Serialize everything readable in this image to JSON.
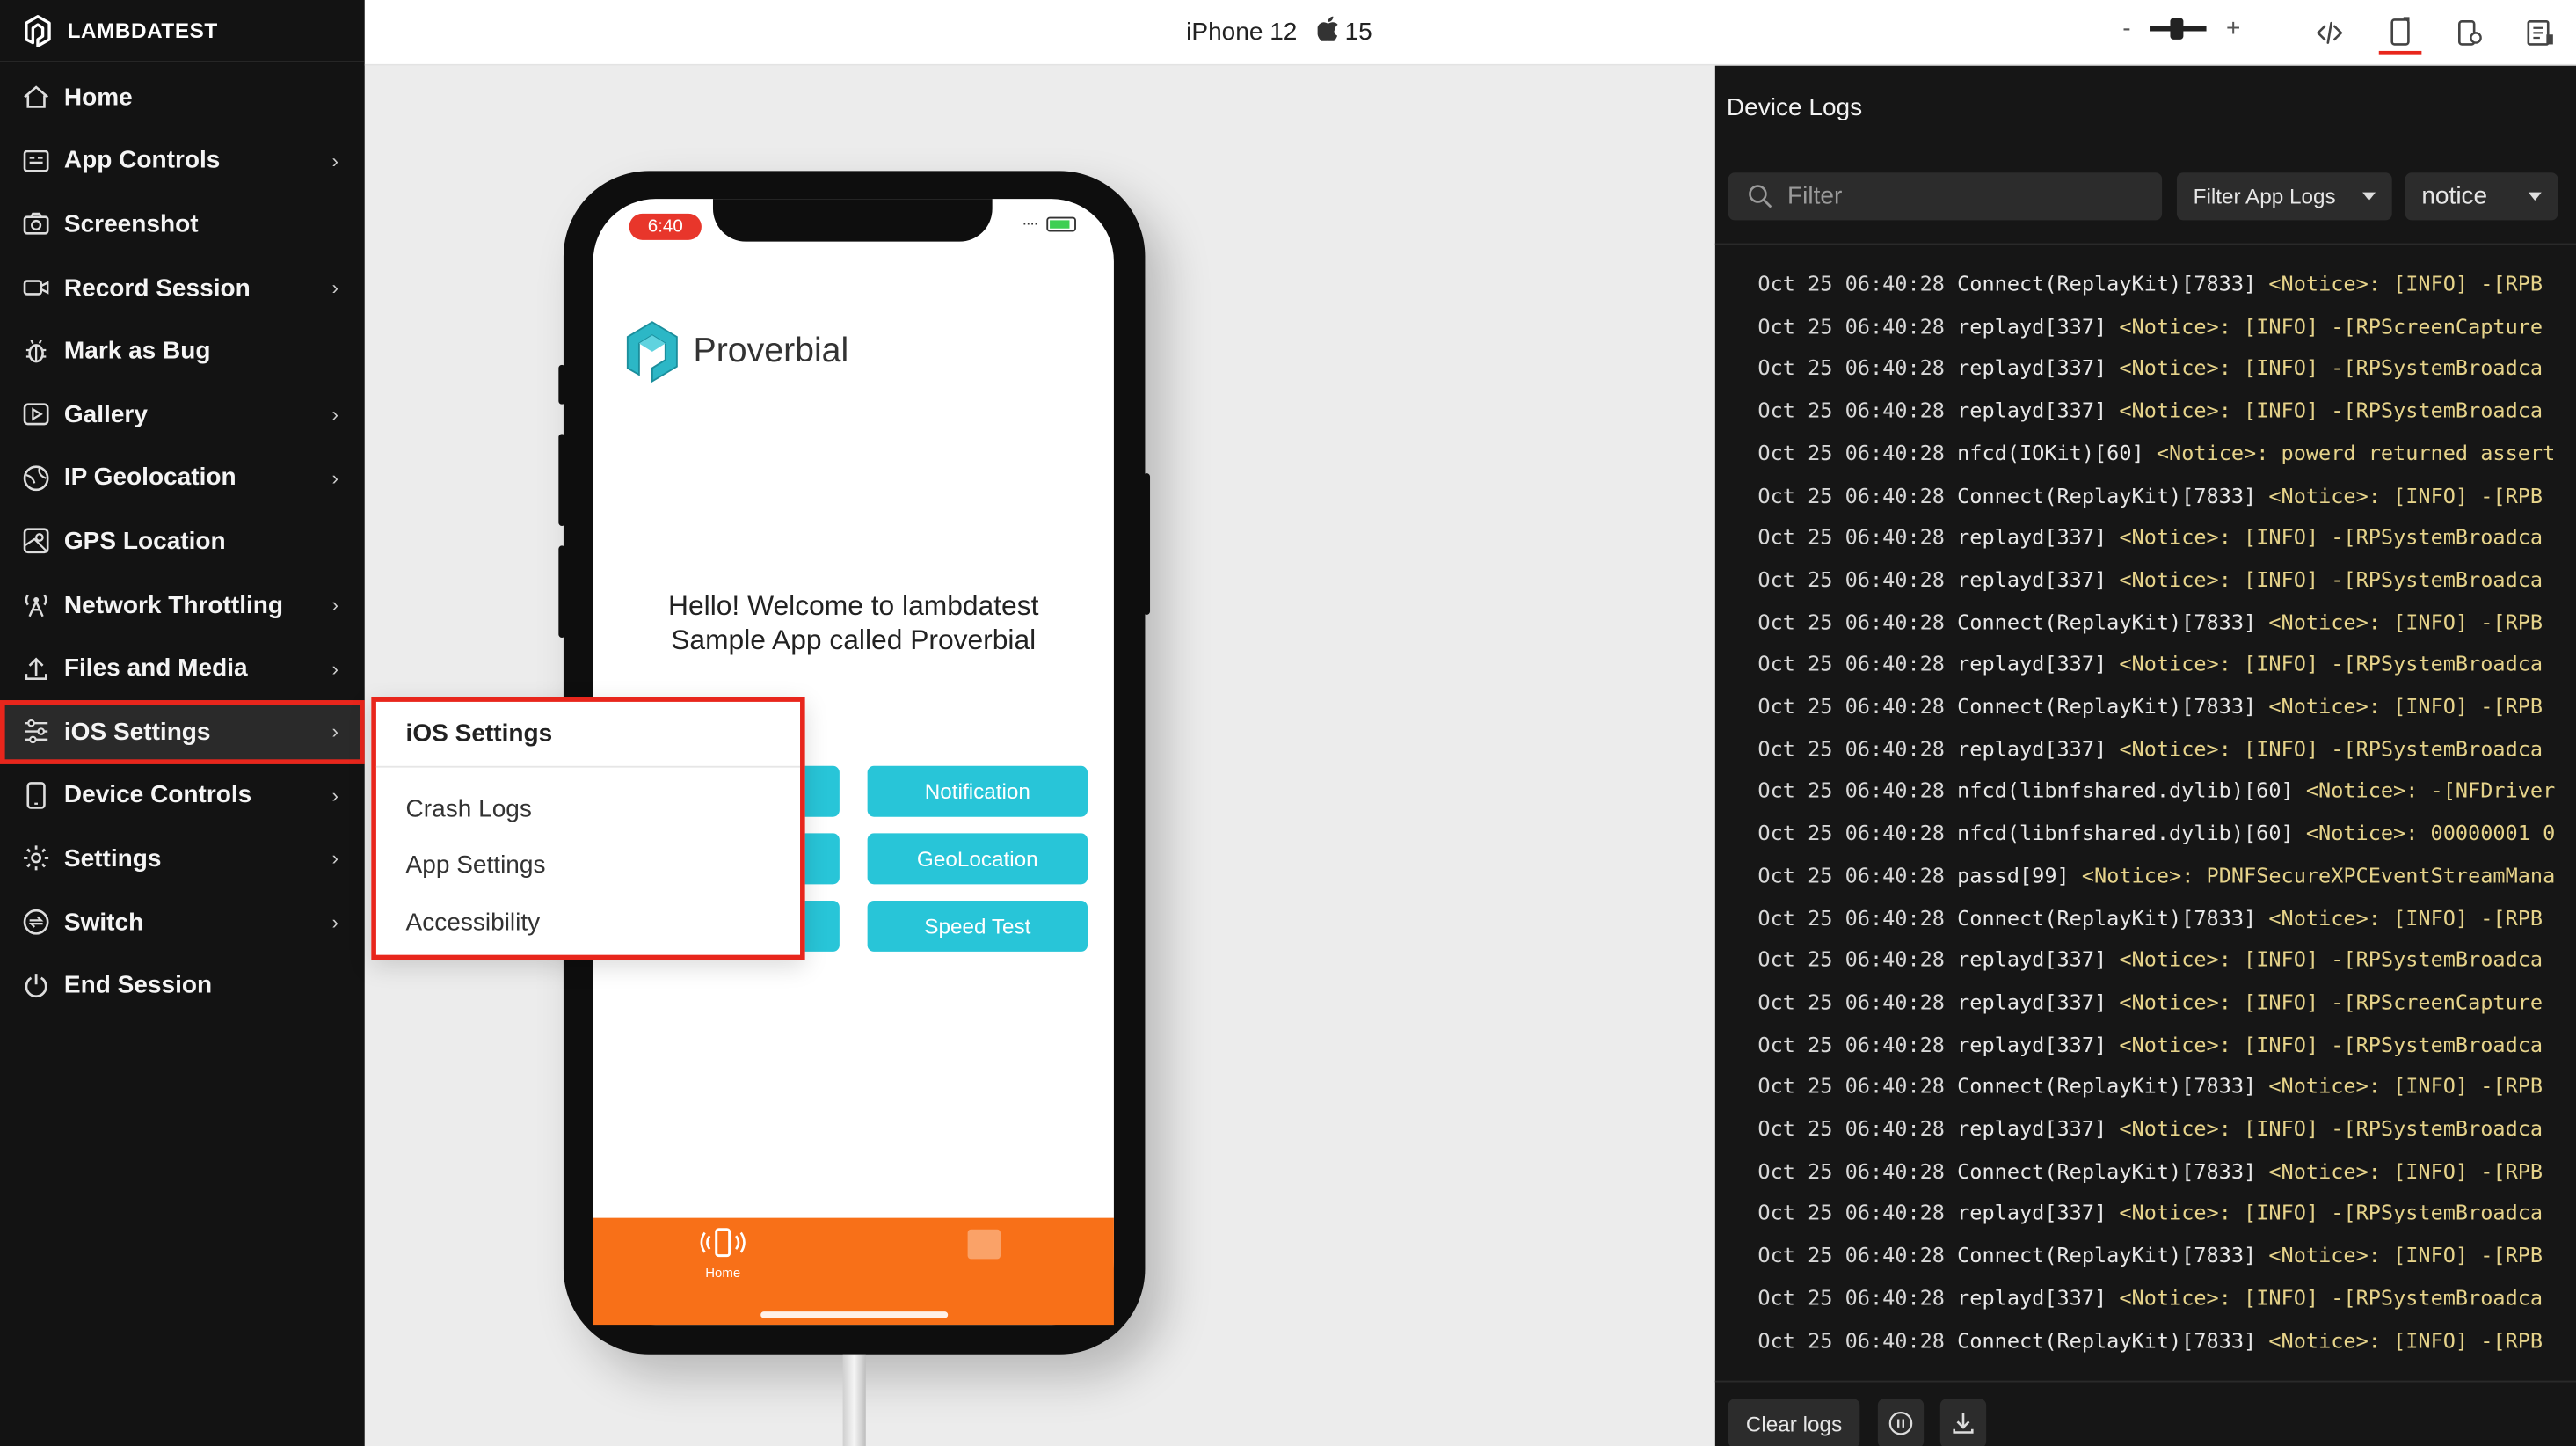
{
  "brand": {
    "name": "LAMBDATEST"
  },
  "sidebar": {
    "items": [
      {
        "label": "Home",
        "icon": "home-icon",
        "chevron": false
      },
      {
        "label": "App Controls",
        "icon": "app-controls-icon",
        "chevron": true
      },
      {
        "label": "Screenshot",
        "icon": "camera-icon",
        "chevron": false
      },
      {
        "label": "Record Session",
        "icon": "video-icon",
        "chevron": true
      },
      {
        "label": "Mark as Bug",
        "icon": "bug-icon",
        "chevron": false
      },
      {
        "label": "Gallery",
        "icon": "gallery-icon",
        "chevron": true
      },
      {
        "label": "IP Geolocation",
        "icon": "globe-icon",
        "chevron": true
      },
      {
        "label": "GPS Location",
        "icon": "map-pin-icon",
        "chevron": false
      },
      {
        "label": "Network Throttling",
        "icon": "antenna-icon",
        "chevron": true
      },
      {
        "label": "Files and Media",
        "icon": "upload-icon",
        "chevron": true
      },
      {
        "label": "iOS Settings",
        "icon": "sliders-icon",
        "chevron": true,
        "active": true
      },
      {
        "label": "Device Controls",
        "icon": "device-icon",
        "chevron": true
      },
      {
        "label": "Settings",
        "icon": "gear-icon",
        "chevron": true
      },
      {
        "label": "Switch",
        "icon": "switch-icon",
        "chevron": true
      },
      {
        "label": "End Session",
        "icon": "power-icon",
        "chevron": false
      }
    ],
    "chevron_glyph": "›"
  },
  "topbar": {
    "device_name": "iPhone 12",
    "os_version": "15",
    "zoom_minus": "-",
    "zoom_plus": "+"
  },
  "submenu": {
    "title": "iOS Settings",
    "items": [
      "Crash Logs",
      "App Settings",
      "Accessibility"
    ]
  },
  "phone": {
    "time": "6:40",
    "app_name": "Proverbial",
    "welcome_line1": "Hello! Welcome to lambdatest",
    "welcome_line2": "Sample App called Proverbial",
    "buttons": [
      "Notification",
      "GeoLocation",
      "Speed Test"
    ],
    "tab_home_label": "Home"
  },
  "logs": {
    "title": "Device Logs",
    "filter_placeholder": "Filter",
    "filter_app_logs": "Filter App Logs",
    "level": "notice",
    "clear_label": "Clear logs",
    "lines": [
      {
        "date": "Oct 25 06:40:28",
        "source": "Connect(ReplayKit)[7833]",
        "msg": "<Notice>:  [INFO] -[RPB"
      },
      {
        "date": "Oct 25 06:40:28",
        "source": "replayd[337]",
        "msg": "<Notice>:  [INFO] -[RPScreenCapture"
      },
      {
        "date": "Oct 25 06:40:28",
        "source": "replayd[337]",
        "msg": "<Notice>:  [INFO] -[RPSystemBroadca"
      },
      {
        "date": "Oct 25 06:40:28",
        "source": "replayd[337]",
        "msg": "<Notice>:  [INFO] -[RPSystemBroadca"
      },
      {
        "date": "Oct 25 06:40:28",
        "source": "nfcd(IOKit)[60]",
        "msg": "<Notice>: powerd returned assert"
      },
      {
        "date": "Oct 25 06:40:28",
        "source": "Connect(ReplayKit)[7833]",
        "msg": "<Notice>:  [INFO] -[RPB"
      },
      {
        "date": "Oct 25 06:40:28",
        "source": "replayd[337]",
        "msg": "<Notice>:  [INFO] -[RPSystemBroadca"
      },
      {
        "date": "Oct 25 06:40:28",
        "source": "replayd[337]",
        "msg": "<Notice>:  [INFO] -[RPSystemBroadca"
      },
      {
        "date": "Oct 25 06:40:28",
        "source": "Connect(ReplayKit)[7833]",
        "msg": "<Notice>:  [INFO] -[RPB"
      },
      {
        "date": "Oct 25 06:40:28",
        "source": "replayd[337]",
        "msg": "<Notice>:  [INFO] -[RPSystemBroadca"
      },
      {
        "date": "Oct 25 06:40:28",
        "source": "Connect(ReplayKit)[7833]",
        "msg": "<Notice>:  [INFO] -[RPB"
      },
      {
        "date": "Oct 25 06:40:28",
        "source": "replayd[337]",
        "msg": "<Notice>:  [INFO] -[RPSystemBroadca"
      },
      {
        "date": "Oct 25 06:40:28",
        "source": "nfcd(libnfshared.dylib)[60]",
        "msg": "<Notice>: -[NFDriver"
      },
      {
        "date": "Oct 25 06:40:28",
        "source": "nfcd(libnfshared.dylib)[60]",
        "msg": "<Notice>: 00000001 0"
      },
      {
        "date": "Oct 25 06:40:28",
        "source": "passd[99]",
        "msg": "<Notice>: PDNFSecureXPCEventStreamMana"
      },
      {
        "date": "Oct 25 06:40:28",
        "source": "Connect(ReplayKit)[7833]",
        "msg": "<Notice>:  [INFO] -[RPB"
      },
      {
        "date": "Oct 25 06:40:28",
        "source": "replayd[337]",
        "msg": "<Notice>:  [INFO] -[RPSystemBroadca"
      },
      {
        "date": "Oct 25 06:40:28",
        "source": "replayd[337]",
        "msg": "<Notice>:  [INFO] -[RPScreenCapture"
      },
      {
        "date": "Oct 25 06:40:28",
        "source": "replayd[337]",
        "msg": "<Notice>:  [INFO] -[RPSystemBroadca"
      },
      {
        "date": "Oct 25 06:40:28",
        "source": "Connect(ReplayKit)[7833]",
        "msg": "<Notice>:  [INFO] -[RPB"
      },
      {
        "date": "Oct 25 06:40:28",
        "source": "replayd[337]",
        "msg": "<Notice>:  [INFO] -[RPSystemBroadca"
      },
      {
        "date": "Oct 25 06:40:28",
        "source": "Connect(ReplayKit)[7833]",
        "msg": "<Notice>:  [INFO] -[RPB"
      },
      {
        "date": "Oct 25 06:40:28",
        "source": "replayd[337]",
        "msg": "<Notice>:  [INFO] -[RPSystemBroadca"
      },
      {
        "date": "Oct 25 06:40:28",
        "source": "Connect(ReplayKit)[7833]",
        "msg": "<Notice>:  [INFO] -[RPB"
      },
      {
        "date": "Oct 25 06:40:28",
        "source": "replayd[337]",
        "msg": "<Notice>:  [INFO] -[RPSystemBroadca"
      },
      {
        "date": "Oct 25 06:40:28",
        "source": "Connect(ReplayKit)[7833]",
        "msg": "<Notice>:  [INFO] -[RPB"
      }
    ]
  },
  "colors": {
    "accent_red": "#e8261c",
    "app_orange": "#f87018",
    "app_teal": "#28c5d8",
    "sidebar_bg": "#131313",
    "logs_bg": "#161616"
  }
}
